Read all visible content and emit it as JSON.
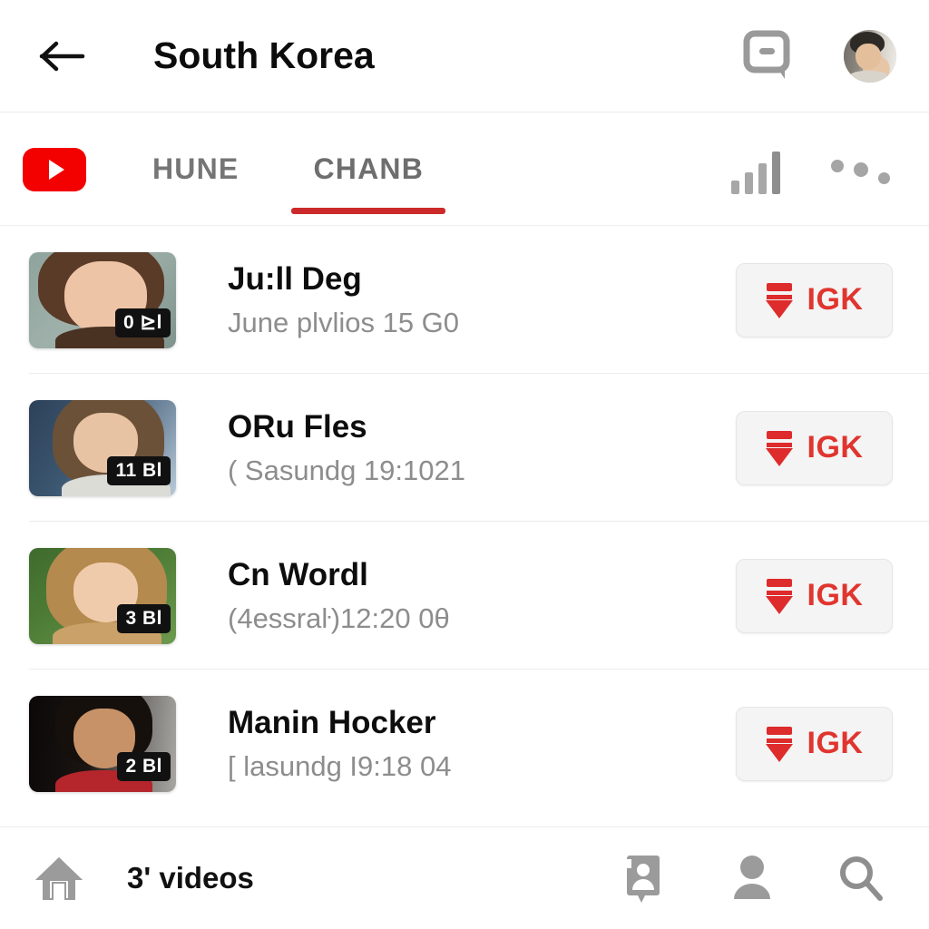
{
  "header": {
    "title": "South Korea",
    "back_icon": "back-arrow-icon",
    "chat_icon": "chat-bubble-icon",
    "avatar_name": "user-avatar"
  },
  "tabbar": {
    "logo_icon": "youtube-logo-icon",
    "tabs": [
      {
        "label": "HUNE",
        "active": false
      },
      {
        "label": "CHANB",
        "active": true
      }
    ],
    "analytics_icon": "bar-chart-icon",
    "more_icon": "more-options-icon",
    "active_indicator_color": "#cc2a2a"
  },
  "list": {
    "rows": [
      {
        "title": "Ju:ll Deg",
        "subtitle": "June plvlios 15 G0",
        "badge": "0 ⊵l",
        "button_label": "IGK",
        "button_icon": "download-icon"
      },
      {
        "title": "ORu Fles",
        "subtitle": "( Ѕasundg 19:1021",
        "badge": "11 Bl",
        "button_label": "IGK",
        "button_icon": "download-icon"
      },
      {
        "title": "Cn Wordl",
        "subtitle": "(4essraŀ)12:20 0θ",
        "badge": "3 Bl",
        "button_label": "IGK",
        "button_icon": "download-icon"
      },
      {
        "title": "Manin Hocker",
        "subtitle": "[ lasundg I9:18 04",
        "badge": "2 Bl",
        "button_label": "IGK",
        "button_icon": "download-icon"
      }
    ]
  },
  "bottombar": {
    "home_icon": "home-icon",
    "label": "3' videos",
    "contact_icon": "contact-card-icon",
    "person_icon": "person-icon",
    "search_icon": "search-icon"
  },
  "colors": {
    "brand_red": "#f30000",
    "accent_red": "#e0352f",
    "text_primary": "#0d0d0d",
    "text_secondary": "#8d8d8d",
    "icon_gray": "#8e8e8e",
    "divider": "#ededed"
  }
}
